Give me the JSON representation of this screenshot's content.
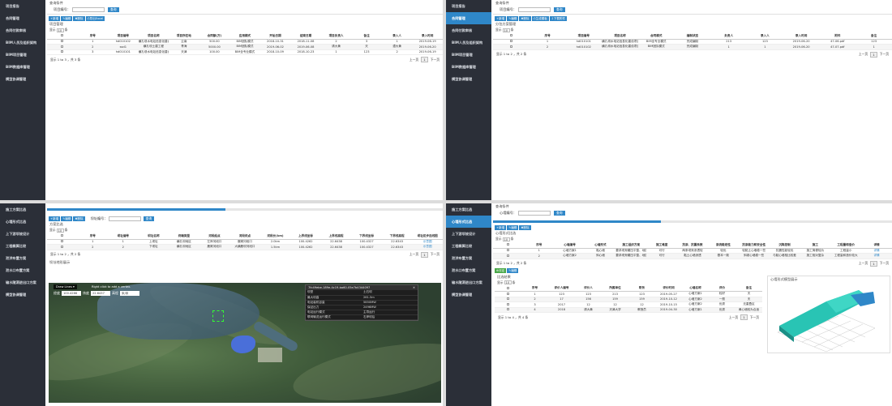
{
  "q1": {
    "sidebar": [
      "项目报告",
      "合同管理",
      "合同付款审核",
      "BIM人员及组织架构",
      "BIM项目管理",
      "BIM数据库管理",
      "模型协调管理"
    ],
    "active": -1,
    "search": {
      "title": "查询条件",
      "label": "项目编号：",
      "btn": "查询"
    },
    "toolbar": [
      "+新增",
      "✎编辑",
      "✖删除",
      "⎙导出Excel"
    ],
    "list_title": "项目管理",
    "show": "显示",
    "show_n": "10",
    "show_unit": "条",
    "headers": [
      "",
      "序号",
      "项目编号",
      "项目名称",
      "项目所在地",
      "合同额(万)",
      "应用模式",
      "开始日期",
      "结束日期",
      "项目负责人",
      "备注",
      "录入人",
      "录入时间"
    ],
    "rows": [
      [
        "",
        "1",
        "hd010102",
        "横孔坝水电站信息化建设项目",
        "云南",
        "500.00",
        "BIM团队模式",
        "2018-10-31",
        "2018-11-08",
        "2",
        "3",
        "1",
        "2019-06-19"
      ],
      [
        "",
        "2",
        "ssd1",
        "横孔坝土建工程",
        "青海",
        "5000.00",
        "BIM团队模式",
        "2019-06-02",
        "2019-06-08",
        "请大黄",
        "天",
        "谭大黄",
        "2019-06-20"
      ],
      [
        "",
        "3",
        "hd010101",
        "横孔坝水电站信息化建设项目（BIM管理）",
        "天津",
        "100.00",
        "BIM全专业模式",
        "2018-10-09",
        "2018-10-23",
        "1",
        "123",
        "2",
        "2019-06-19"
      ]
    ],
    "footer": "显示 1 to 3 ，共 3 条",
    "prev": "上一页",
    "page": "1",
    "next": "下一页"
  },
  "q2": {
    "sidebar": [
      "项目报告",
      "合同管理",
      "合同付款审核",
      "BIM人员及组织架构",
      "BIM项目管理",
      "BIM数据库管理",
      "模型协调管理"
    ],
    "active": 1,
    "search": {
      "title": "查询条件",
      "label": "项目编号：",
      "btn": "查询"
    },
    "toolbar": [
      "+新增",
      "✎编辑",
      "✖删除",
      "⎙生成模板",
      "⇩下载附件"
    ],
    "list_title": "分包方案管理",
    "show": "显示",
    "show_n": "10",
    "show_unit": "条",
    "headers": [
      "",
      "序号",
      "项目编号",
      "项目名称",
      "合同模式",
      "编制状态",
      "负责人",
      "录入人",
      "录入时间",
      "附件",
      "备注"
    ],
    "rows": [
      [
        "",
        "1",
        "hd010101",
        "横孔坝水电站信息化建设项目（BIM管理）",
        "BIM全专业模式",
        "完成编制",
        "213",
        "123",
        "2019-06-20",
        "47-06.pdf",
        "123"
      ],
      [
        "",
        "2",
        "hd010102",
        "横孔坝水电站信息化建设项目",
        "BIM团队模式",
        "完成编制",
        "1",
        "1",
        "2019-06-20",
        "47-07.pdf",
        "1"
      ]
    ],
    "footer": "显示 1 to 2 ，共 2 条",
    "prev": "上一页",
    "page": "1",
    "next": "下一页"
  },
  "q3": {
    "sidebar": [
      "施工方案比选",
      "心墙形式比选",
      "上下游坝坡设计",
      "工程概算比较",
      "泄洪布置方案",
      "泄水口布置方案",
      "输水隧洞进出口方案",
      "模型协调管理"
    ],
    "progress": 0.45,
    "toolbar": [
      "+新增",
      "✎编辑",
      "✖删除"
    ],
    "search_label": "坝址编号：",
    "btn": "查询",
    "list_title": "方案比选",
    "show": "显示",
    "show_n": "10",
    "show_unit": "条",
    "headers": [
      "",
      "序号",
      "坝址编号",
      "坝址名称",
      "终端类型",
      "河段起点",
      "河段终点",
      "河段长(km)",
      "上界线坐标",
      "上界线高程",
      "下界线坐标",
      "下界线高程",
      "坝址初步选线图"
    ],
    "rows": [
      [
        "",
        "1",
        "1",
        "上坝址",
        "横孔坝地区",
        "左岸河段口",
        "鹿窝河段口",
        "2.0km",
        "100.4262",
        "22.6438",
        "100.4327",
        "22.6343",
        "示意图"
      ],
      [
        "",
        "2",
        "2",
        "下坝址",
        "横孔坝地区",
        "鹿窝河段口",
        "大横鹿坝河段口",
        "1.5km",
        "100.4262",
        "22.6438",
        "100.4327",
        "22.6343",
        "示意图"
      ]
    ],
    "footer": "显示 1 to 2 ，共 2 条",
    "prev": "上一页",
    "page": "1",
    "next": "下一页",
    "map_title": "坝址地形展示",
    "draw_lines": "Draw Lines",
    "draw_hint": "Right click to add a vertex.",
    "coord": {
      "lng_label": "经度",
      "lng": "100.4266",
      "lat_label": "纬度",
      "lat": "22.6437",
      "alt_label": "高程",
      "alt": "米/米"
    },
    "popup": {
      "id": "7fc49ebe-189e-4c19-ba60-05e7b4344097",
      "rows": [
        [
          "坝型",
          "土石坝"
        ],
        [
          "最大坝高",
          "261.5m"
        ],
        [
          "电站装机容量",
          "5850MW"
        ],
        [
          "保证出力",
          "2496MW"
        ],
        [
          "电站运行模式",
          "主导运行"
        ],
        [
          "联网输送运行模式",
          "右岸坝后"
        ]
      ]
    }
  },
  "q4": {
    "sidebar": [
      "施工方案比选",
      "心墙形式比选",
      "上下游坝坡设计",
      "工程概算比较",
      "泄洪布置方案",
      "泄水口布置方案",
      "输水隧洞进出口方案",
      "模型协调管理"
    ],
    "active": 1,
    "search": {
      "title": "查询条件",
      "label": "心墙编号：",
      "btn": "查询"
    },
    "progress": 0.42,
    "toolbar": [
      "+新增",
      "✎编辑",
      "✖删除"
    ],
    "list_title": "心墙形式比选",
    "show": "显示",
    "show_n": "10",
    "show_unit": "条",
    "headers": [
      "",
      "序号",
      "心墙编号",
      "心墙形式",
      "施工组织方案",
      "施工难度",
      "抗渗、抗震系数",
      "渗流稳定性",
      "抗渗能力和安全性",
      "沉降控制",
      "施工",
      "工程量和造价",
      "详情"
    ],
    "rows": [
      [
        "",
        "1",
        "心墙方案1",
        "黏心墙",
        "要求坝壳碾压平整、地质条件较好",
        "可行",
        "两条坝壳渗透较",
        "较优",
        "较黏土心墙稳一些",
        "抗震性能较优",
        "施工简便较为",
        "工程量小",
        "详情"
      ],
      [
        "",
        "2",
        "心墙方案2",
        "斜心墙",
        "要求坝壳碾压平整、地质条件较好",
        "可行",
        "黏土心墙渗透",
        "基本一致",
        "斜坡心墙稳一些",
        "与黏心墙相比较差",
        "施工相对复杂",
        "工程量和造价较大",
        "详情"
      ]
    ],
    "footer": "显示 1 to 2 ，共 2 条",
    "prev": "上一页",
    "page": "1",
    "next": "下一页",
    "toolbar2": [
      "⊕评定",
      "✎编辑"
    ],
    "eval_title": "比选结果",
    "eval_headers": [
      "",
      "序号",
      "评价人编号",
      "评价人",
      "所属单位",
      "职务",
      "评价时间",
      "心墙名称",
      "评价",
      "备注"
    ],
    "eval_rows": [
      [
        "",
        "1",
        "123",
        "123",
        "213",
        "123",
        "2019-05-27",
        "心墙方案1",
        "较好",
        "天"
      ],
      [
        "",
        "2",
        "17",
        "156",
        "159",
        "159",
        "2019-10-12",
        "心墙方案2",
        "一般",
        "天"
      ],
      [
        "",
        "3",
        "2017",
        "12",
        "12",
        "12",
        "2019-10-15",
        "心墙方案2",
        "优秀",
        "无重叠区"
      ],
      [
        "",
        "4",
        "2018",
        "请大黄",
        "天津大学",
        "教授员",
        "2019-04-30",
        "心墙方案1",
        "优秀",
        "黄心墙较为合适"
      ]
    ],
    "eval_footer": "显示 1 to 4 ，共 4 条",
    "model_title": "心墙形式模型展示"
  }
}
